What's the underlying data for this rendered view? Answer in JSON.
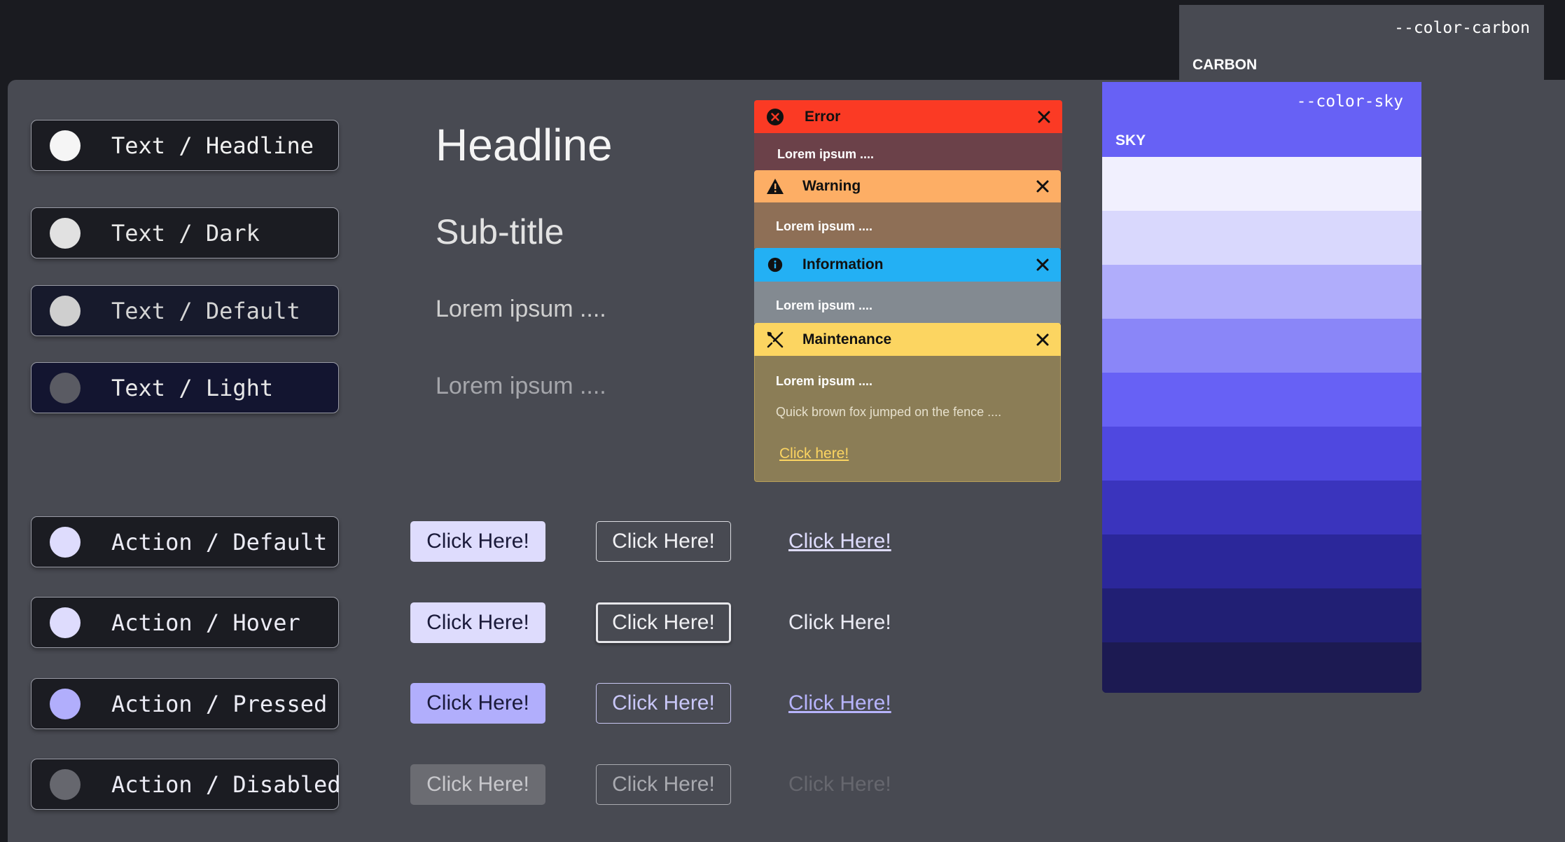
{
  "palettes": {
    "carbon": {
      "variable": "--color-carbon",
      "label": "CARBON",
      "swatches": [
        "#f2f2f2",
        "#dcdcdc",
        "#c5c5c7",
        "#b0b0b3",
        "#9c9ca0",
        "#88898e",
        "#76777d",
        "#65666c",
        "#57585f",
        "#4a4b52",
        "#31323b",
        "#15172a"
      ]
    },
    "sky": {
      "variable": "--color-sky",
      "label": "SKY",
      "swatches": [
        "#f1f0fe",
        "#d9d8fd",
        "#b0adfb",
        "#8a86f8",
        "#6761f5",
        "#4f48e0",
        "#3a34bd",
        "#2b279a",
        "#211f74",
        "#1c1a52"
      ]
    }
  },
  "text_tokens": [
    {
      "label": "Text / Headline",
      "color": "#f5f5f5"
    },
    {
      "label": "Text / Dark",
      "color": "#e1e1e1"
    },
    {
      "label": "Text / Default",
      "color": "#cfcfcf"
    },
    {
      "label": "Text / Light",
      "color": "#5a5b63"
    }
  ],
  "action_tokens": [
    {
      "label": "Action / Default",
      "color": "#dedcfd"
    },
    {
      "label": "Action / Hover",
      "color": "#dedcfd"
    },
    {
      "label": "Action / Pressed",
      "color": "#b1aefc"
    },
    {
      "label": "Action / Disabled",
      "color": "#66676e"
    }
  ],
  "type_samples": {
    "headline": "Headline",
    "subtitle": "Sub-title",
    "body_default": "Lorem ipsum ....",
    "body_light": "Lorem ipsum ...."
  },
  "buttons": {
    "label": "Click Here!",
    "states": [
      "default",
      "hover",
      "pressed",
      "disabled"
    ]
  },
  "alerts": [
    {
      "type": "error",
      "title": "Error",
      "body": "Lorem ipsum ....",
      "header_color": "#fb3a24",
      "body_color": "#6b4149",
      "icon": "x-circle-icon"
    },
    {
      "type": "warning",
      "title": "Warning",
      "body": "Lorem ipsum ....",
      "header_color": "#fdae65",
      "body_color": "#8e6f56",
      "icon": "warning-triangle-icon"
    },
    {
      "type": "information",
      "title": "Information",
      "body": "Lorem ipsum ....",
      "header_color": "#23b0f4",
      "body_color": "#838a91",
      "icon": "info-circle-icon"
    },
    {
      "type": "maintenance",
      "title": "Maintenance",
      "body": "Lorem ipsum ....",
      "extra": "Quick brown fox jumped on the fence ....",
      "link": "Click here!",
      "header_color": "#fcd561",
      "body_color": "#8b7d56",
      "icon": "tools-icon"
    }
  ]
}
